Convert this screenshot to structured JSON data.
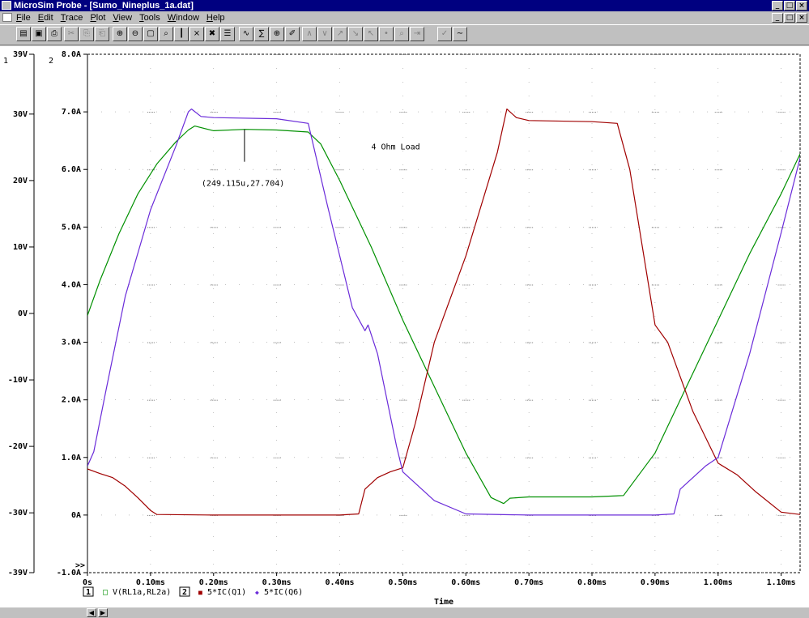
{
  "window": {
    "title": "MicroSim Probe - [Sumo_Nineplus_1a.dat]"
  },
  "caption_buttons": [
    "_",
    "□",
    "×"
  ],
  "menu": [
    "File",
    "Edit",
    "Trace",
    "Plot",
    "View",
    "Tools",
    "Window",
    "Help"
  ],
  "toolbar": {
    "buttons": [
      {
        "name": "open-file-icon",
        "glyph": "▤"
      },
      {
        "name": "save-icon",
        "glyph": "▣"
      },
      {
        "name": "print-icon",
        "glyph": "⎙"
      },
      {
        "name": "cut-icon",
        "glyph": "✂",
        "disabled": true
      },
      {
        "name": "copy-icon",
        "glyph": "⎘",
        "disabled": true
      },
      {
        "name": "paste-icon",
        "glyph": "⎗",
        "disabled": true
      },
      {
        "name": "zoom-in-icon",
        "glyph": "⊕"
      },
      {
        "name": "zoom-out-icon",
        "glyph": "⊖"
      },
      {
        "name": "zoom-area-icon",
        "glyph": "▢"
      },
      {
        "name": "zoom-fit-icon",
        "glyph": "⌕"
      },
      {
        "name": "axis-settings-icon",
        "glyph": "┃"
      },
      {
        "name": "x-axis-icon",
        "glyph": "⨯"
      },
      {
        "name": "add-trace-icon",
        "glyph": "✖"
      },
      {
        "name": "trace-list-icon",
        "glyph": "☰"
      },
      {
        "name": "fourier-icon",
        "glyph": "∿"
      },
      {
        "name": "eval-goal-icon",
        "glyph": "∑"
      },
      {
        "name": "cursor-icon",
        "glyph": "⊕"
      },
      {
        "name": "label-icon",
        "glyph": "✐"
      },
      {
        "name": "cursor-peak-icon",
        "glyph": "∧",
        "disabled": true
      },
      {
        "name": "cursor-trough-icon",
        "glyph": "∨",
        "disabled": true
      },
      {
        "name": "cursor-slope-icon",
        "glyph": "↗",
        "disabled": true
      },
      {
        "name": "cursor-min-icon",
        "glyph": "↘",
        "disabled": true
      },
      {
        "name": "cursor-max-icon",
        "glyph": "↖",
        "disabled": true
      },
      {
        "name": "cursor-point-icon",
        "glyph": "•",
        "disabled": true
      },
      {
        "name": "cursor-search-icon",
        "glyph": "⌕",
        "disabled": true
      },
      {
        "name": "cursor-next-icon",
        "glyph": "⇥",
        "disabled": true
      },
      {
        "name": "mark-label-icon",
        "glyph": "✓",
        "disabled": true
      },
      {
        "name": "mark-point-icon",
        "glyph": "∼"
      }
    ]
  },
  "chart_data": {
    "type": "line",
    "x_axis": {
      "label": "Time",
      "range_ms": [
        0,
        1.13
      ],
      "ticks_ms": [
        0,
        0.1,
        0.2,
        0.3,
        0.4,
        0.5,
        0.6,
        0.7,
        0.8,
        0.9,
        1.0,
        1.1
      ],
      "tick_labels": [
        "0s",
        "0.10ms",
        "0.20ms",
        "0.30ms",
        "0.40ms",
        "0.50ms",
        "0.60ms",
        "0.70ms",
        "0.80ms",
        "0.90ms",
        "1.00ms",
        "1.10ms"
      ]
    },
    "y_axis_1": {
      "id": "1",
      "range": [
        -39,
        39
      ],
      "ticks": [
        39,
        30,
        20,
        10,
        0,
        -10,
        -20,
        -30,
        -39
      ],
      "tick_labels": [
        "39V",
        "30V",
        "20V",
        "10V",
        "0V",
        "-10V",
        "-20V",
        "-30V",
        "-39V"
      ]
    },
    "y_axis_2": {
      "id": "2",
      "range": [
        -1,
        8
      ],
      "ticks": [
        8,
        7,
        6,
        5,
        4,
        3,
        2,
        1,
        0,
        -1
      ],
      "tick_labels": [
        "8.0A",
        "7.0A",
        "6.0A",
        "5.0A",
        "4.0A",
        "3.0A",
        "2.0A",
        "1.0A",
        "0A",
        "-1.0A"
      ]
    },
    "grid": true,
    "series": [
      {
        "name": "V(RL1a,RL2a)",
        "axis": "1",
        "color": "#009000",
        "marker": "□",
        "x": [
          0,
          0.02,
          0.05,
          0.08,
          0.11,
          0.14,
          0.16,
          0.17,
          0.2,
          0.25,
          0.3,
          0.35,
          0.37,
          0.4,
          0.45,
          0.5,
          0.55,
          0.6,
          0.64,
          0.66,
          0.67,
          0.7,
          0.8,
          0.85,
          0.9,
          0.95,
          1.0,
          1.05,
          1.1,
          1.13
        ],
        "y": [
          -0.3,
          5,
          12,
          18,
          22.5,
          25.8,
          27.6,
          28.2,
          27.5,
          27.7,
          27.6,
          27.3,
          25.5,
          20,
          10,
          -1,
          -11,
          -21,
          -27.7,
          -28.6,
          -27.8,
          -27.6,
          -27.6,
          -27.4,
          -21,
          -11,
          -1,
          9,
          18,
          24
        ]
      },
      {
        "name": "5*IC(Q1)",
        "axis": "2",
        "color": "#a00000",
        "marker": "■",
        "x": [
          0,
          0.02,
          0.04,
          0.06,
          0.08,
          0.1,
          0.11,
          0.2,
          0.3,
          0.4,
          0.43,
          0.44,
          0.46,
          0.48,
          0.5,
          0.52,
          0.55,
          0.6,
          0.65,
          0.665,
          0.68,
          0.7,
          0.8,
          0.84,
          0.86,
          0.9,
          0.92,
          0.94,
          0.96,
          1.0,
          1.03,
          1.06,
          1.1,
          1.13
        ],
        "y": [
          0.8,
          0.72,
          0.65,
          0.5,
          0.3,
          0.08,
          0.01,
          0.0,
          0.0,
          0.0,
          0.02,
          0.45,
          0.65,
          0.75,
          0.82,
          1.6,
          3.0,
          4.5,
          6.3,
          7.05,
          6.9,
          6.85,
          6.83,
          6.8,
          6.0,
          3.3,
          3.0,
          2.4,
          1.8,
          0.9,
          0.7,
          0.4,
          0.05,
          0.01
        ]
      },
      {
        "name": "5*IC(Q6)",
        "axis": "2",
        "color": "#6a2bd9",
        "marker": "◆",
        "x": [
          0,
          0.01,
          0.03,
          0.06,
          0.1,
          0.14,
          0.16,
          0.165,
          0.18,
          0.2,
          0.3,
          0.35,
          0.38,
          0.42,
          0.44,
          0.445,
          0.46,
          0.49,
          0.5,
          0.52,
          0.55,
          0.6,
          0.7,
          0.8,
          0.9,
          0.93,
          0.94,
          0.96,
          0.98,
          1.0,
          1.05,
          1.1,
          1.13
        ],
        "y": [
          0.85,
          1.1,
          2.2,
          3.8,
          5.3,
          6.4,
          7.0,
          7.05,
          6.92,
          6.9,
          6.88,
          6.8,
          5.4,
          3.6,
          3.2,
          3.3,
          2.8,
          1.2,
          0.75,
          0.55,
          0.25,
          0.02,
          0.0,
          0.0,
          0.0,
          0.02,
          0.45,
          0.65,
          0.85,
          1.0,
          2.8,
          4.9,
          6.2
        ]
      }
    ],
    "annotations": [
      {
        "text": "4 Ohm Load",
        "x_ms": 0.45,
        "y_A": 6.35
      },
      {
        "text": "(249.115u,27.704)",
        "x_ms": 0.249,
        "y_V": 27.704
      }
    ],
    "legend": {
      "placement": "bottom-left",
      "groups": [
        {
          "axis_id": "1",
          "items": [
            "V(RL1a,RL2a)"
          ]
        },
        {
          "axis_id": "2",
          "items": [
            "5*IC(Q1)",
            "5*IC(Q6)"
          ]
        }
      ]
    },
    "offscale_marker": ">>"
  }
}
